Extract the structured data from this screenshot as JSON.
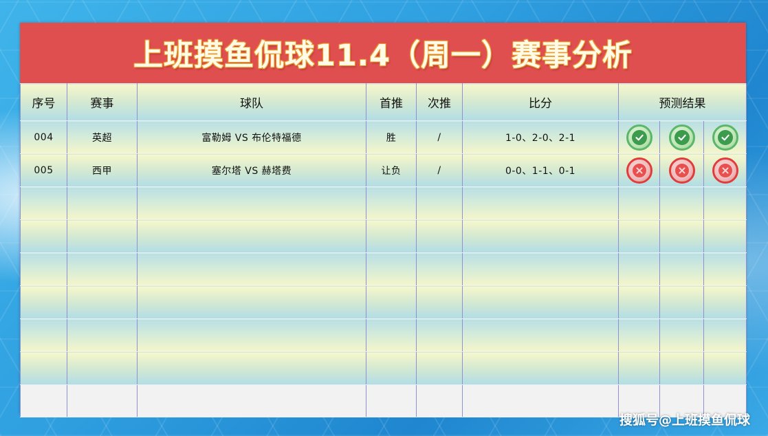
{
  "title": "上班摸鱼侃球11.4（周一）赛事分析",
  "headers": {
    "seq": "序号",
    "league": "赛事",
    "teams": "球队",
    "first": "首推",
    "second": "次推",
    "score": "比分",
    "result": "预测结果"
  },
  "rows": [
    {
      "seq": "004",
      "league": "英超",
      "teams": "富勒姆 VS 布伦特福德",
      "first": "胜",
      "second": "/",
      "score": "1-0、2-0、2-1",
      "results": [
        "correct",
        "correct",
        "correct"
      ]
    },
    {
      "seq": "005",
      "league": "西甲",
      "teams": "塞尔塔 VS 赫塔费",
      "first": "让负",
      "second": "/",
      "score": "0-0、1-1、0-1",
      "results": [
        "wrong",
        "wrong",
        "wrong"
      ]
    }
  ],
  "icons": {
    "correct": "check-circle-icon",
    "wrong": "cross-circle-icon"
  },
  "colors": {
    "title_bg": "#e04f50",
    "correct": "#3d9b4e",
    "wrong": "#e85050"
  },
  "watermark": "搜狐号@上班摸鱼侃球"
}
